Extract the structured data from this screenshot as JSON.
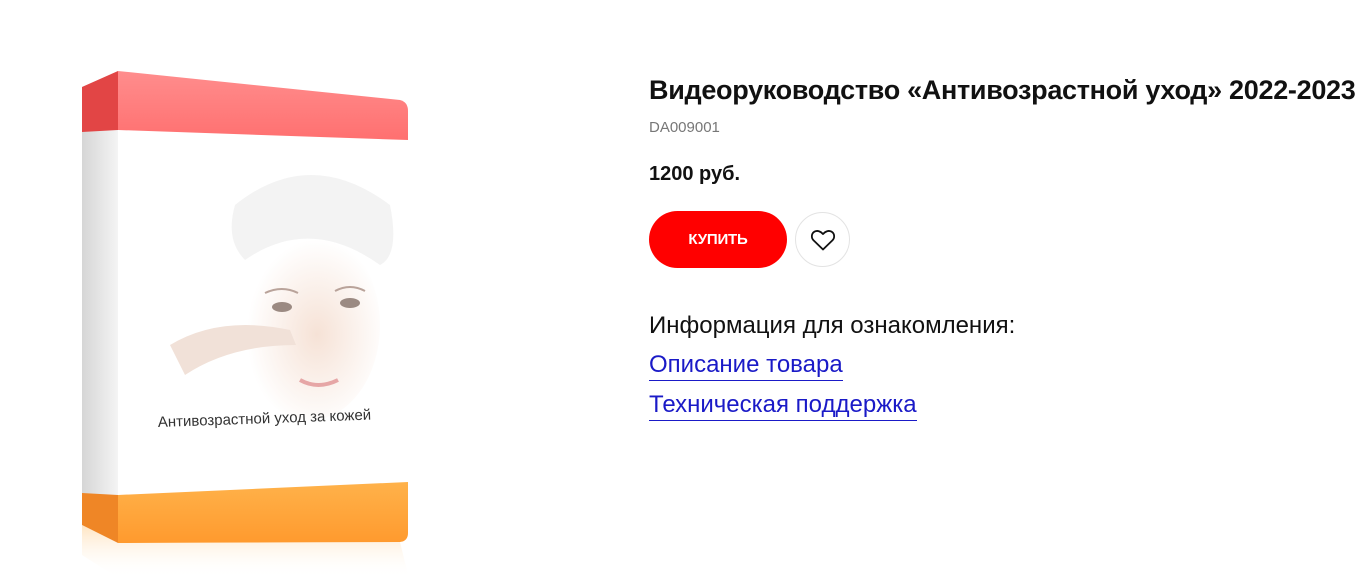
{
  "product": {
    "title": "Видеоруководство «Антивозрастной уход» 2022-2023",
    "sku": "DA009001",
    "price": "1200 руб.",
    "box_caption": "Антивозрастной уход за кожей",
    "box_colors": {
      "top_band": "#ff7d7d",
      "bottom_band": "#ffa640",
      "spine": "#e0e0e0"
    }
  },
  "actions": {
    "buy_label": "КУПИТЬ",
    "favorite_icon": "heart-icon",
    "buy_color": "#ff0000"
  },
  "info": {
    "heading": "Информация для ознакомления:",
    "links": [
      {
        "label": "Описание товара"
      },
      {
        "label": "Техническая поддержка"
      }
    ],
    "link_color": "#1a1ac7"
  }
}
